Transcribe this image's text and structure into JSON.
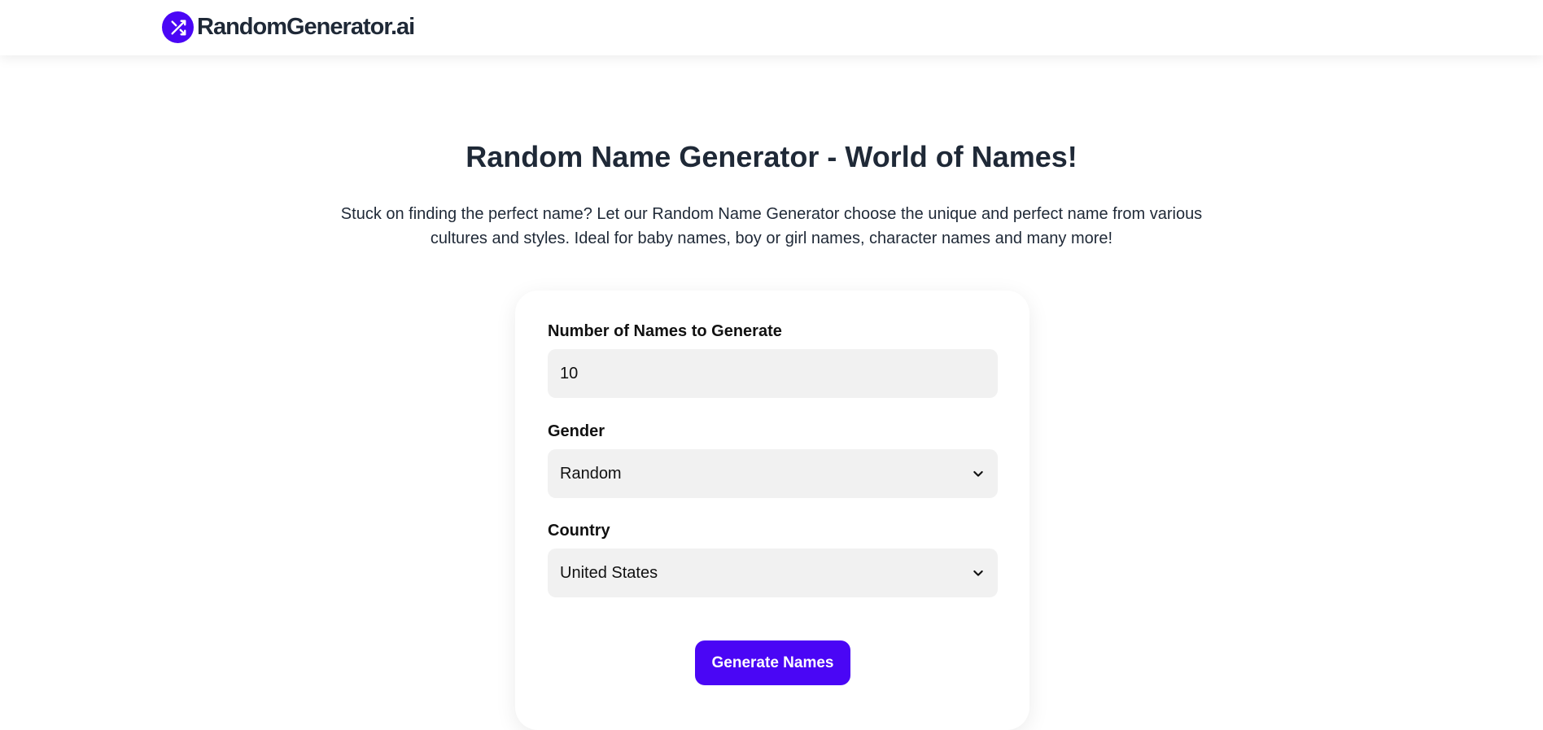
{
  "header": {
    "brand": "RandomGenerator.ai",
    "logo_icon": "shuffle-icon",
    "accent_color": "#4a06f5"
  },
  "hero": {
    "title": "Random Name Generator - World of Names!",
    "description": "Stuck on finding the perfect name? Let our Random Name Generator choose the unique and perfect name from various cultures and styles. Ideal for baby names, boy or girl names, character names and many more!"
  },
  "form": {
    "count": {
      "label": "Number of Names to Generate",
      "value": "10"
    },
    "gender": {
      "label": "Gender",
      "selected": "Random",
      "icon": "chevron-down-icon"
    },
    "country": {
      "label": "Country",
      "selected": "United States",
      "icon": "chevron-down-icon"
    },
    "submit_label": "Generate Names"
  }
}
